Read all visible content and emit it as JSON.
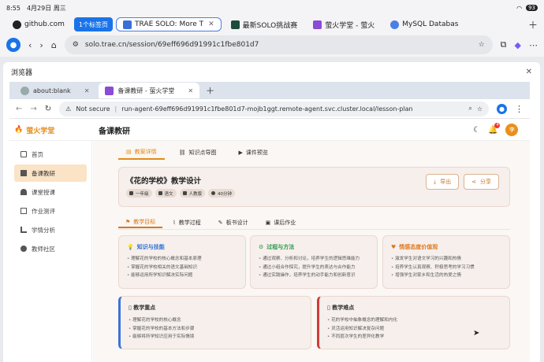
{
  "status_bar": {
    "time": "8:55",
    "date": "4月29日 周三",
    "battery": "93"
  },
  "outer_tabs": [
    {
      "label": "github.com",
      "color": "#222222"
    },
    {
      "label": "1个标签页",
      "group": true
    },
    {
      "label": "TRAE SOLO: More T",
      "color": "#3a6fd8",
      "active": true
    },
    {
      "label": "最新SOLO挑战赛",
      "color": "#1d4d3a"
    },
    {
      "label": "萤火学堂 - 萤火",
      "color": "#8a4bd6"
    },
    {
      "label": "MySQL Databas",
      "color": "#4a7ee8"
    }
  ],
  "outer_url": "solo.trae.cn/session/69eff696d91991c1fbe801d7",
  "window_title": "浏览器",
  "inner_tabs": [
    {
      "label": "about:blank"
    },
    {
      "label": "备课教研 - 萤火学堂",
      "active": true
    }
  ],
  "inner_url": {
    "security": "Not secure",
    "address": "run-agent-69eff696d91991c1fbe801d7-mojb1ggt.remote-agent.svc.cluster.local/lesson-plan"
  },
  "app": {
    "logo": "萤火学堂",
    "page_title": "备课教研",
    "notification_count": "4",
    "avatar": "李"
  },
  "sidebar": {
    "items": [
      {
        "label": "首页"
      },
      {
        "label": "备课教研",
        "active": true
      },
      {
        "label": "课堂授课"
      },
      {
        "label": "作业测评"
      },
      {
        "label": "学情分析"
      },
      {
        "label": "教师社区"
      }
    ]
  },
  "view_tabs": [
    "教案详情",
    "知识点导图",
    "课件预览"
  ],
  "lesson": {
    "title": "《花的学校》教学设计",
    "badges": [
      "一年级",
      "语文",
      "人教版",
      "40分钟"
    ],
    "export_label": "导出",
    "share_label": "分享"
  },
  "section_tabs": [
    "教学目标",
    "教学过程",
    "板书设计",
    "课后作业"
  ],
  "goals": [
    {
      "title": "知识与技能",
      "color": "#2f6fd6",
      "items": [
        "理解花的学校的核心概念和基本原理",
        "掌握花的学校相关的语文基础知识",
        "能够运用所学知识解决实际问题"
      ]
    },
    {
      "title": "过程与方法",
      "color": "#2c9a4b",
      "items": [
        "通过观察、分析和讨论，培养学生的逻辑思维能力",
        "通过小组合作探究，提升学生的表达与合作能力",
        "通过实践操作，培养学生的动手能力和创新意识"
      ]
    },
    {
      "title": "情感态度价值观",
      "color": "#e07a1f",
      "items": [
        "激发学生对语文学习的兴趣和热情",
        "培养学生认真观察、积极思考的学习习惯",
        "增强学生对家乡和生活的热爱之情"
      ]
    }
  ],
  "key_points": {
    "title": "▯ 教学重点",
    "items": [
      "理解花的学校的核心概念",
      "掌握花的学校的基本方法和步骤",
      "能够将所学知识应用于实际情境"
    ]
  },
  "difficult_points": {
    "title": "▯ 教学难点",
    "items": [
      "花的学校中抽象概念的理解和内化",
      "灵活运用知识解决复杂问题",
      "不同层次学生的差异化教学"
    ]
  }
}
